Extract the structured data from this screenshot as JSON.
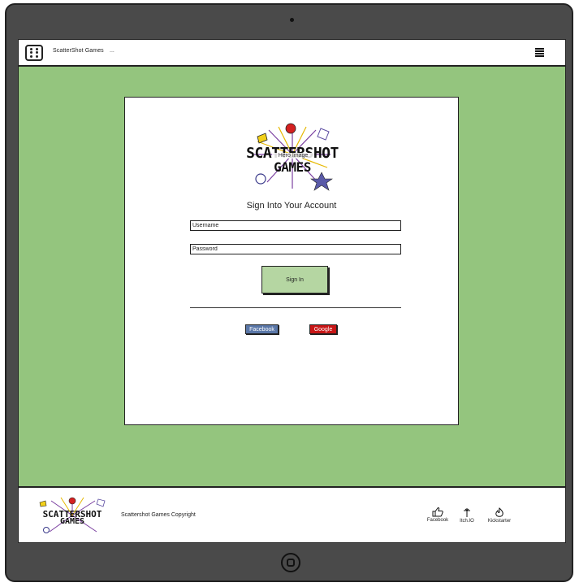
{
  "nav": {
    "brand": "ScatterShot Games",
    "extra": "..."
  },
  "hero": {
    "title_line1": "SCATTERSHOT",
    "title_line2": "GAMES",
    "label": "Hero Image"
  },
  "signin_form": {
    "title": "Sign Into Your Account",
    "username_placeholder": "Username",
    "password_placeholder": "Password",
    "submit_label": "Sign In",
    "facebook_label": "Facebook",
    "google_label": "Google"
  },
  "footer": {
    "logo_line1": "SCATTERSHOT",
    "logo_line2": "GAMES",
    "copyright": "Scattershot Games Copyright",
    "links": [
      {
        "label": "Facebook",
        "icon": "thumbs-up-icon"
      },
      {
        "label": "Itch.IO",
        "icon": "sword-icon"
      },
      {
        "label": "Kickstarter",
        "icon": "flame-icon"
      }
    ]
  },
  "colors": {
    "main_background": "#94c57e",
    "signin_button": "#b5d6a2",
    "facebook": "#5a77a8",
    "google": "#c81616"
  }
}
